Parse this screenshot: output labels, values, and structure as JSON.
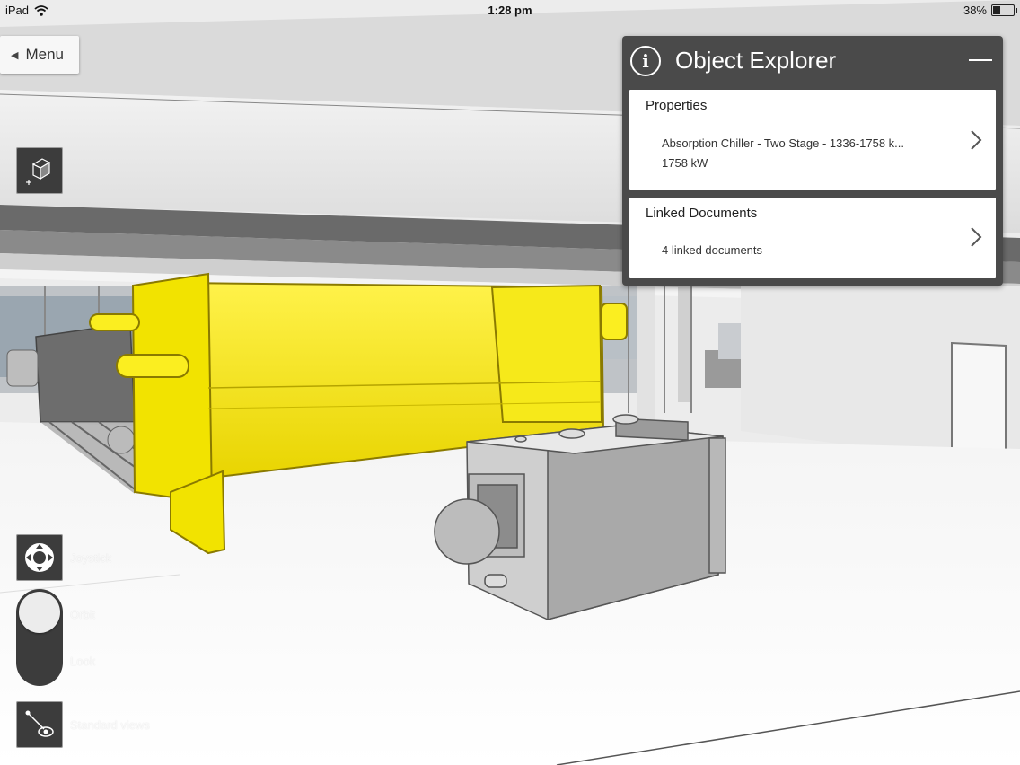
{
  "status_bar": {
    "device": "iPad",
    "time": "1:28 pm",
    "battery": "38%",
    "battery_level": 0.38
  },
  "menu": {
    "label": "Menu"
  },
  "controls": {
    "joystick_label": "Joystick",
    "orbit_label": "Orbit",
    "look_label": "Look",
    "standard_views_label": "Standard views"
  },
  "object_explorer": {
    "title": "Object Explorer",
    "properties": {
      "heading": "Properties",
      "name": "Absorption Chiller - Two Stage - 1336-1758 k...",
      "capacity": "1758 kW"
    },
    "linked_documents": {
      "heading": "Linked Documents",
      "summary": "4 linked documents"
    }
  },
  "colors": {
    "highlight": "#f7e600",
    "panel": "#4a4a4a",
    "control": "#3c3c3c"
  },
  "icons": [
    "wifi-icon",
    "battery-icon",
    "back-triangle-icon",
    "add-box-icon",
    "info-icon",
    "minimize-icon",
    "chevron-right-icon",
    "joystick-icon",
    "orbit-knob-icon",
    "standard-views-icon"
  ]
}
